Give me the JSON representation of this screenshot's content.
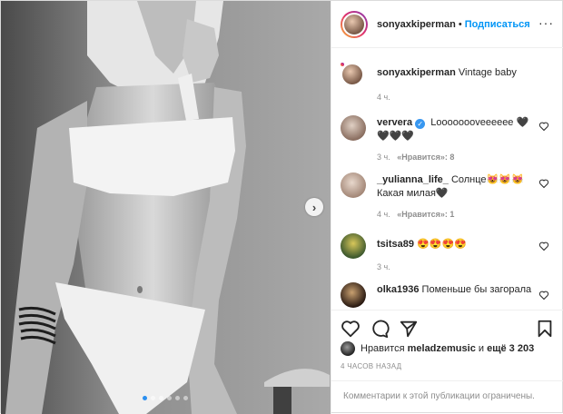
{
  "post": {
    "author": "sonyaxkiperman",
    "separator": "•",
    "follow_label": "Подписаться",
    "more_label": "···",
    "next_label": "›",
    "slides": 6,
    "active_slide": 1
  },
  "caption": {
    "user": "sonyaxkiperman",
    "text": "Vintage baby",
    "time": "4 ч."
  },
  "comments": [
    {
      "user": "ververa",
      "verified": true,
      "text": "Loooooooveeeeee 🖤🖤🖤🖤",
      "time": "3 ч.",
      "likes": "«Нравится»: 8"
    },
    {
      "user": "_yulianna_life_",
      "verified": false,
      "text": "Солнце😻😻😻 Какая милая🖤",
      "time": "4 ч.",
      "likes": "«Нравится»: 1"
    },
    {
      "user": "tsitsa89",
      "verified": false,
      "text": "😍😍😍😍",
      "time": "3 ч.",
      "likes": ""
    },
    {
      "user": "olka1936",
      "verified": false,
      "text": "Поменьше бы загорала",
      "time": "",
      "likes": ""
    }
  ],
  "likes_line": {
    "prefix": "Нравится",
    "user": "meladzemusic",
    "conj": "и",
    "rest": "ещё 3 203"
  },
  "time_ago": "4 ЧАСОВ НАЗАД",
  "restricted_text": "Комментарии к этой публикации ограничены.",
  "icons": {
    "like": "heart-outline-icon",
    "comment": "comment-bubble-icon",
    "share": "paper-plane-icon",
    "save": "bookmark-icon",
    "comment_like": "small-heart-icon",
    "more": "ellipsis-icon",
    "next": "chevron-right-icon"
  }
}
